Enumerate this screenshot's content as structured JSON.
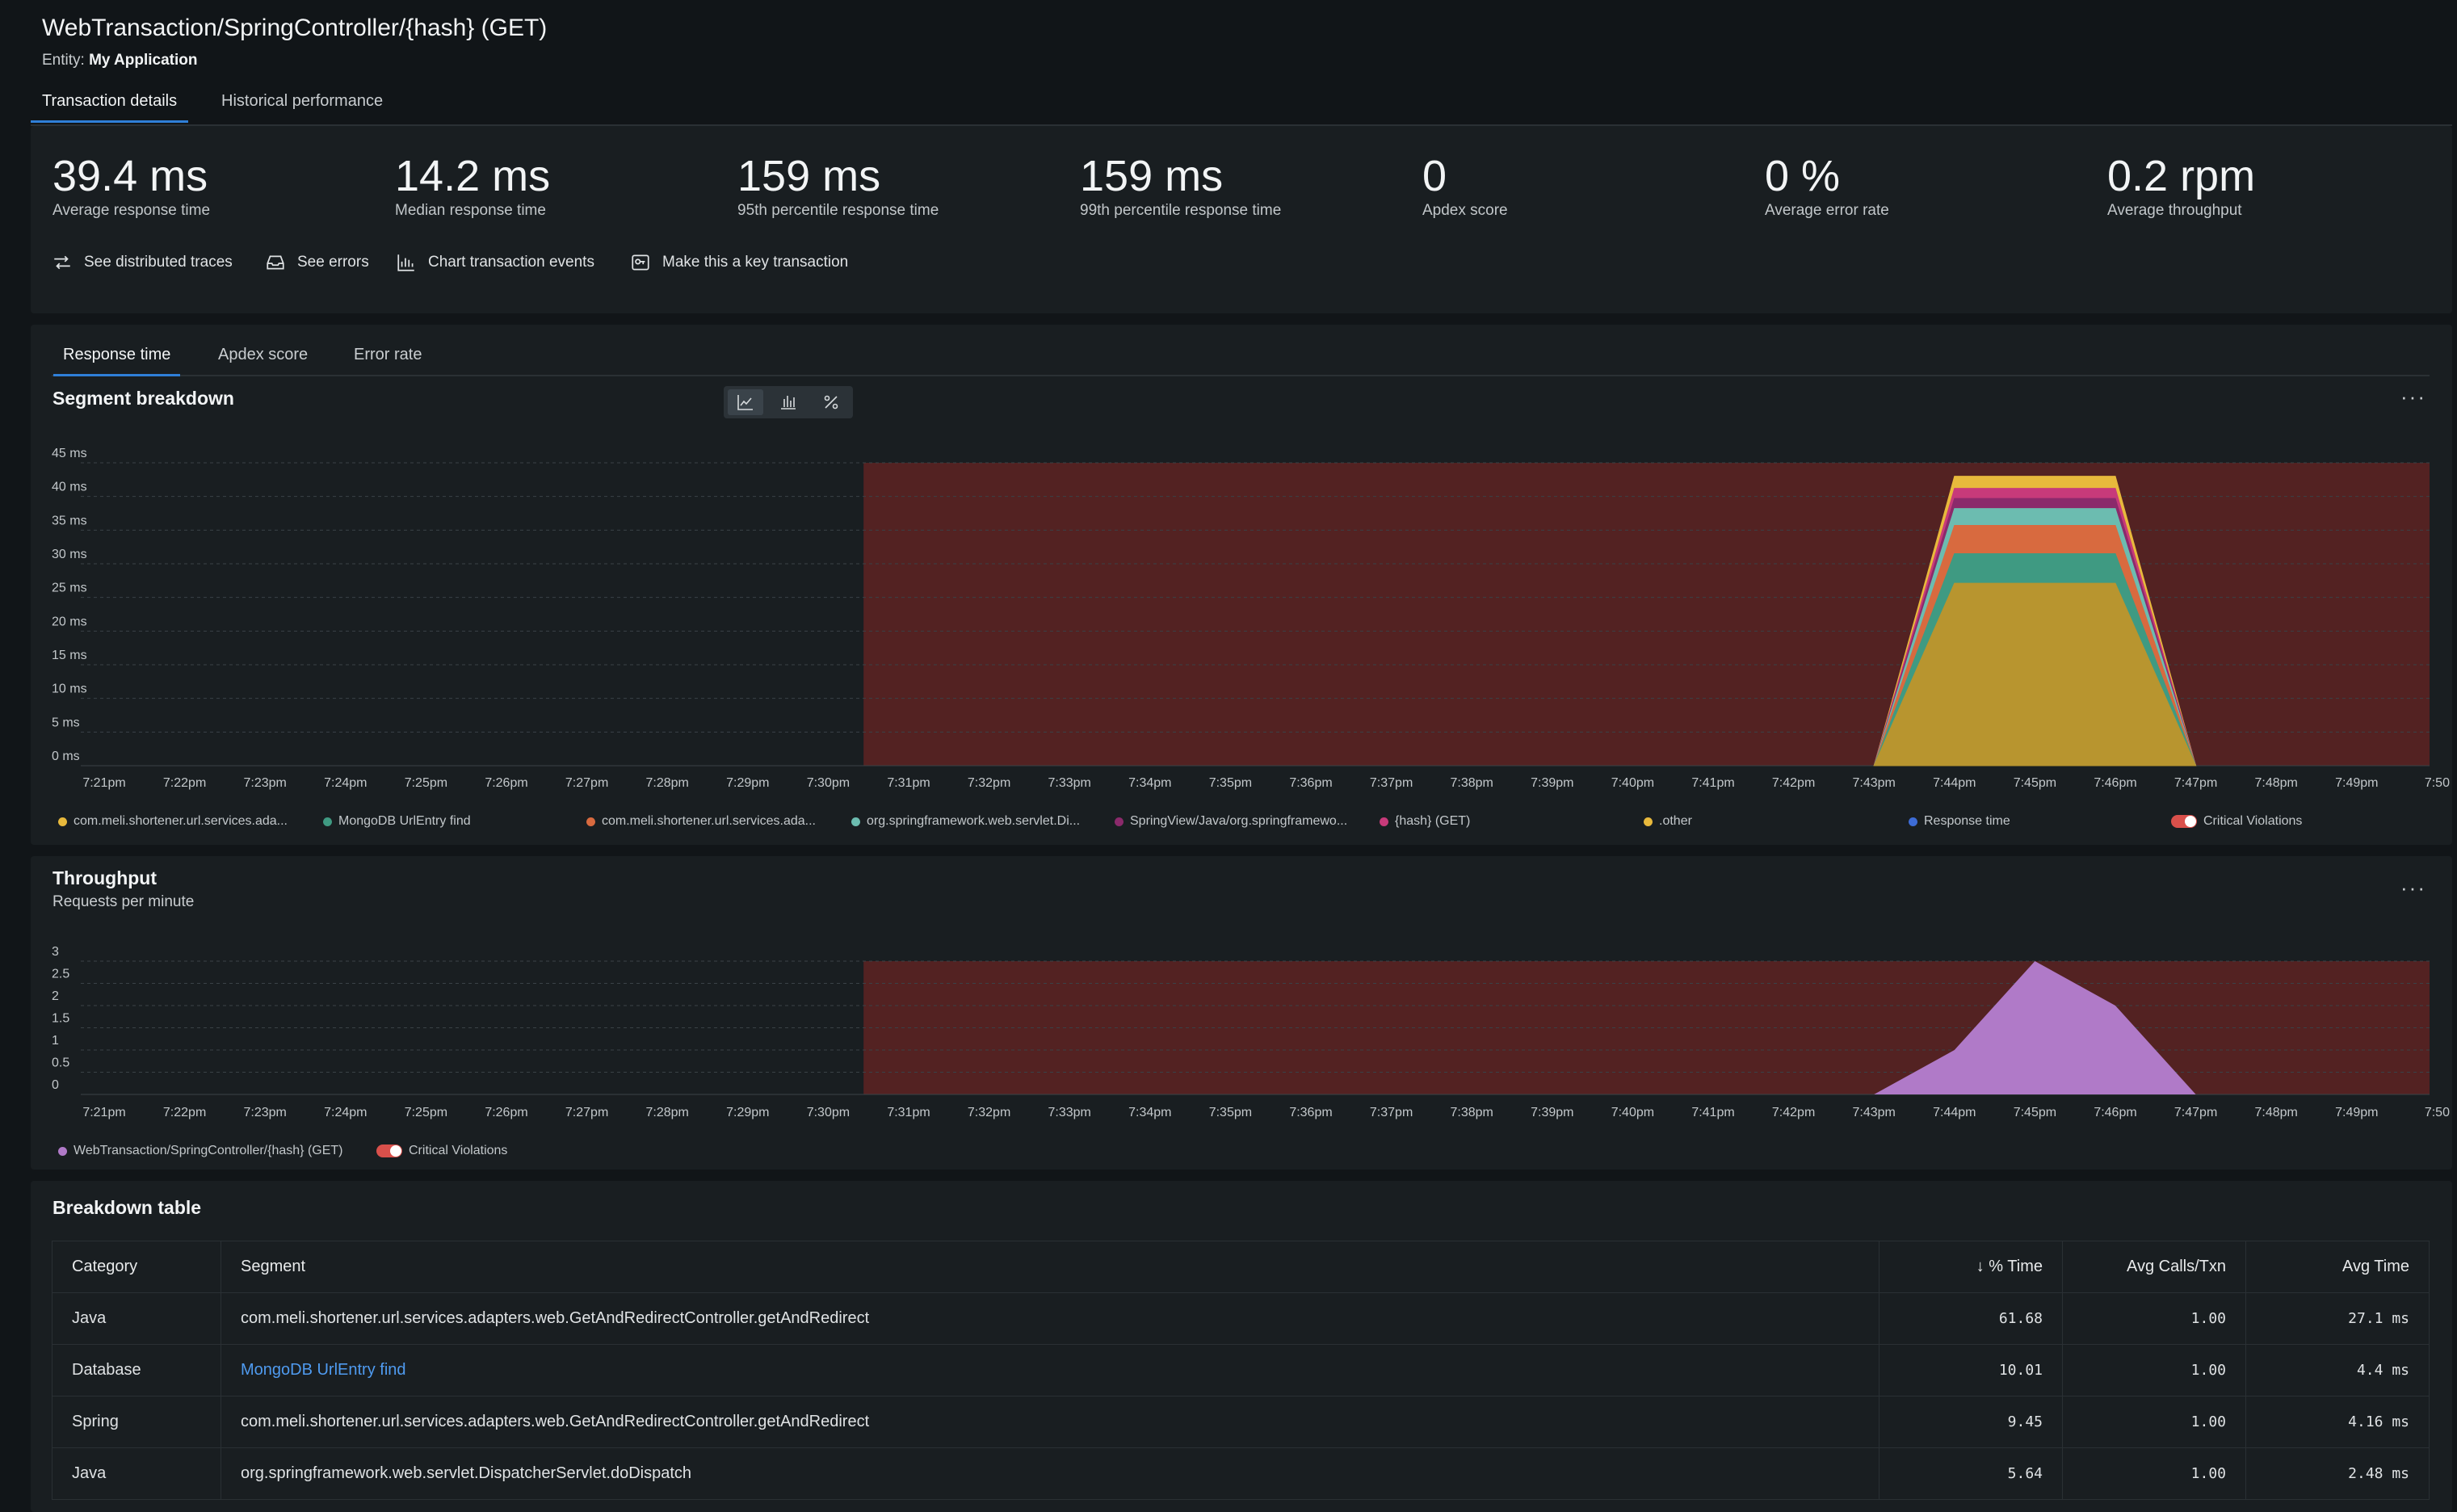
{
  "header": {
    "title": "WebTransaction/SpringController/{hash} (GET)",
    "entity_label": "Entity:",
    "entity_name": "My Application"
  },
  "top_tabs": [
    {
      "label": "Transaction details",
      "active": true
    },
    {
      "label": "Historical performance",
      "active": false
    }
  ],
  "metrics": [
    {
      "value": "39.4 ms",
      "label": "Average response time"
    },
    {
      "value": "14.2 ms",
      "label": "Median response time"
    },
    {
      "value": "159 ms",
      "label": "95th percentile response time"
    },
    {
      "value": "159 ms",
      "label": "99th percentile response time"
    },
    {
      "value": "0",
      "label": "Apdex score"
    },
    {
      "value": "0 %",
      "label": "Average error rate"
    },
    {
      "value": "0.2 rpm",
      "label": "Average throughput"
    }
  ],
  "actions": [
    {
      "label": "See distributed traces",
      "icon": "distributed-traces-icon"
    },
    {
      "label": "See errors",
      "icon": "errors-inbox-icon"
    },
    {
      "label": "Chart transaction events",
      "icon": "chart-icon"
    },
    {
      "label": "Make this a key transaction",
      "icon": "key-transaction-icon"
    }
  ],
  "chart_tabs": [
    {
      "label": "Response time",
      "active": true
    },
    {
      "label": "Apdex score",
      "active": false
    },
    {
      "label": "Error rate",
      "active": false
    }
  ],
  "colors": {
    "violation_bg": "#532222",
    "seg_java": "#b8952f",
    "seg_mongo": "#3f9a82",
    "seg_spring": "#d86a3f",
    "seg_dispatcher": "#6cbcb0",
    "seg_springview": "#8b2a6b",
    "seg_hash": "#c73a7a",
    "seg_other": "#e8b93c",
    "response_time": "#3d6cd6",
    "throughput": "#b07ac8",
    "accent": "#2f7fd8"
  },
  "segment_chart": {
    "title": "Segment breakdown",
    "menu": "···",
    "view_buttons": [
      "line-chart-icon",
      "bar-chart-icon",
      "percent-icon"
    ],
    "legend": [
      {
        "label": "com.meli.shortener.url.services.ada...",
        "color": "#e8b93c"
      },
      {
        "label": "MongoDB UrlEntry find",
        "color": "#3f9a82"
      },
      {
        "label": "com.meli.shortener.url.services.ada...",
        "color": "#d86a3f"
      },
      {
        "label": "org.springframework.web.servlet.Di...",
        "color": "#6cbcb0"
      },
      {
        "label": "SpringView/Java/org.springframewo...",
        "color": "#8b2a6b"
      },
      {
        "label": "{hash} (GET)",
        "color": "#c73a7a"
      },
      {
        "label": ".other",
        "color": "#e8b93c"
      },
      {
        "label": "Response time",
        "color": "#3d6cd6"
      }
    ],
    "violations_label": "Critical Violations"
  },
  "throughput_chart": {
    "title": "Throughput",
    "subtitle": "Requests per minute",
    "menu": "···",
    "legend": [
      {
        "label": "WebTransaction/SpringController/{hash} (GET)",
        "color": "#b07ac8"
      }
    ],
    "violations_label": "Critical Violations"
  },
  "chart_data": [
    {
      "type": "area",
      "title": "Segment breakdown",
      "x": [
        "7:21pm",
        "7:22pm",
        "7:23pm",
        "7:24pm",
        "7:25pm",
        "7:26pm",
        "7:27pm",
        "7:28pm",
        "7:29pm",
        "7:30pm",
        "7:31pm",
        "7:32pm",
        "7:33pm",
        "7:34pm",
        "7:35pm",
        "7:36pm",
        "7:37pm",
        "7:38pm",
        "7:39pm",
        "7:40pm",
        "7:41pm",
        "7:42pm",
        "7:43pm",
        "7:44pm",
        "7:45pm",
        "7:46pm",
        "7:47pm",
        "7:48pm",
        "7:49pm",
        "7:50"
      ],
      "y_ticks": [
        "0 ms",
        "5 ms",
        "10 ms",
        "15 ms",
        "20 ms",
        "25 ms",
        "30 ms",
        "35 ms",
        "40 ms",
        "45 ms"
      ],
      "ylim": [
        0,
        45
      ],
      "stacked": true,
      "series": [
        {
          "name": "com.meli.shortener.url.services.ada...",
          "peak_time": [
            "7:44pm",
            "7:45pm",
            "7:46pm"
          ],
          "values_at_peak": [
            27.1,
            27.1,
            27.1
          ]
        },
        {
          "name": "MongoDB UrlEntry find",
          "values_at_peak": [
            4.4,
            4.4,
            4.4
          ]
        },
        {
          "name": "com.meli.shortener.url.services.ada...",
          "values_at_peak": [
            4.2,
            4.2,
            4.2
          ]
        },
        {
          "name": "org.springframework.web.servlet.Di...",
          "values_at_peak": [
            2.5,
            2.5,
            2.5
          ]
        },
        {
          "name": "SpringView/Java/org.springframewo...",
          "values_at_peak": [
            1.5,
            1.5,
            1.5
          ]
        },
        {
          "name": "{hash} (GET)",
          "values_at_peak": [
            1.5,
            1.5,
            1.5
          ]
        },
        {
          "name": ".other",
          "values_at_peak": [
            1.8,
            1.8,
            1.8
          ]
        }
      ],
      "violation_range": [
        "7:30pm",
        "7:50"
      ]
    },
    {
      "type": "area",
      "title": "Throughput",
      "x": [
        "7:21pm",
        "7:22pm",
        "7:23pm",
        "7:24pm",
        "7:25pm",
        "7:26pm",
        "7:27pm",
        "7:28pm",
        "7:29pm",
        "7:30pm",
        "7:31pm",
        "7:32pm",
        "7:33pm",
        "7:34pm",
        "7:35pm",
        "7:36pm",
        "7:37pm",
        "7:38pm",
        "7:39pm",
        "7:40pm",
        "7:41pm",
        "7:42pm",
        "7:43pm",
        "7:44pm",
        "7:45pm",
        "7:46pm",
        "7:47pm",
        "7:48pm",
        "7:49pm",
        "7:50"
      ],
      "y_ticks": [
        "0",
        "0.5",
        "1",
        "1.5",
        "2",
        "2.5",
        "3"
      ],
      "ylim": [
        0,
        3
      ],
      "series": [
        {
          "name": "WebTransaction/SpringController/{hash} (GET)",
          "x": [
            "7:43pm",
            "7:44pm",
            "7:45pm",
            "7:46pm",
            "7:47pm"
          ],
          "values": [
            0,
            1,
            3,
            2,
            0
          ]
        }
      ],
      "violation_range": [
        "7:30pm",
        "7:50"
      ]
    }
  ],
  "breakdown": {
    "title": "Breakdown table",
    "columns": [
      "Category",
      "Segment",
      "↓ % Time",
      "Avg Calls/Txn",
      "Avg Time"
    ],
    "rows": [
      {
        "category": "Java",
        "segment": "com.meli.shortener.url.services.adapters.web.GetAndRedirectController.getAndRedirect",
        "pct": "61.68",
        "calls": "1.00",
        "avg": "27.1 ms",
        "link": false
      },
      {
        "category": "Database",
        "segment": "MongoDB UrlEntry find",
        "pct": "10.01",
        "calls": "1.00",
        "avg": "4.4 ms",
        "link": true
      },
      {
        "category": "Spring",
        "segment": "com.meli.shortener.url.services.adapters.web.GetAndRedirectController.getAndRedirect",
        "pct": "9.45",
        "calls": "1.00",
        "avg": "4.16 ms",
        "link": false
      },
      {
        "category": "Java",
        "segment": "org.springframework.web.servlet.DispatcherServlet.doDispatch",
        "pct": "5.64",
        "calls": "1.00",
        "avg": "2.48 ms",
        "link": false
      }
    ]
  }
}
